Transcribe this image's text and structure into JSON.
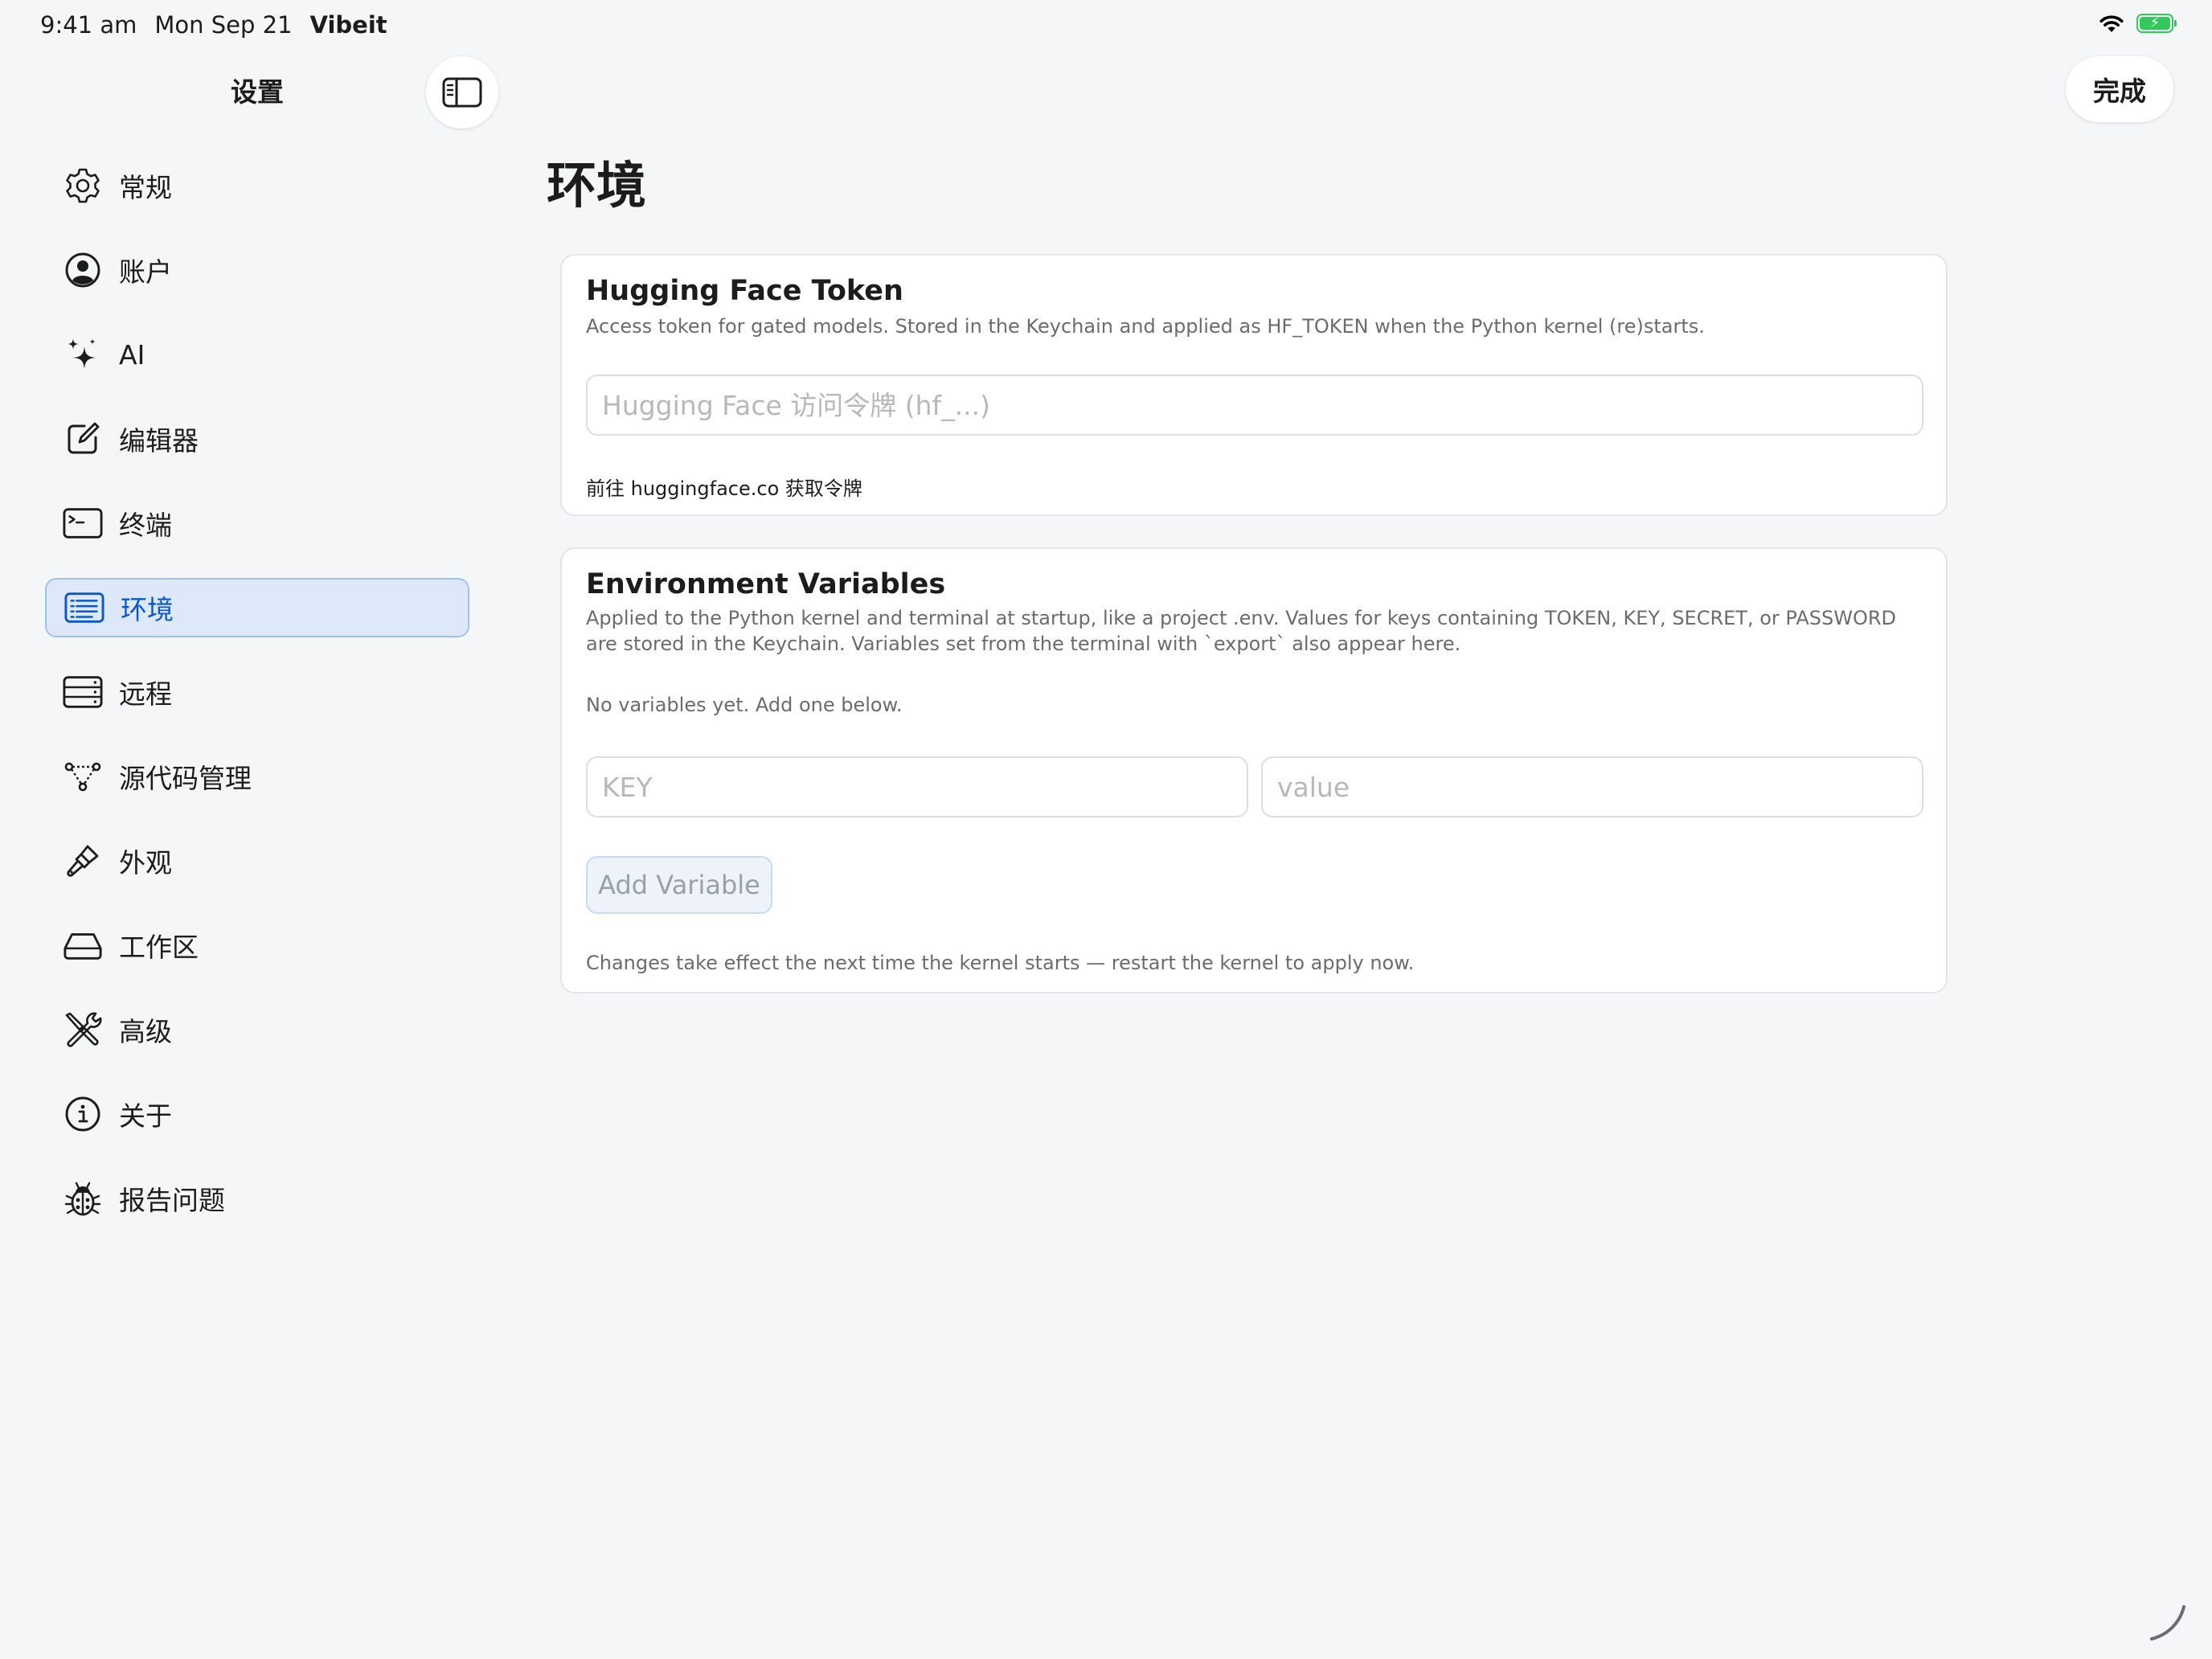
{
  "status_bar": {
    "time": "9:41 am",
    "date": "Mon Sep 21",
    "app": "Vibeit"
  },
  "sidebar": {
    "title": "设置",
    "items": [
      {
        "label": "常规",
        "icon": "gear-icon"
      },
      {
        "label": "账户",
        "icon": "account-icon"
      },
      {
        "label": "AI",
        "icon": "sparkles-icon"
      },
      {
        "label": "编辑器",
        "icon": "edit-icon"
      },
      {
        "label": "终端",
        "icon": "terminal-icon"
      },
      {
        "label": "环境",
        "icon": "list-icon",
        "selected": true
      },
      {
        "label": "远程",
        "icon": "server-icon"
      },
      {
        "label": "源代码管理",
        "icon": "branch-icon"
      },
      {
        "label": "外观",
        "icon": "paintbrush-icon"
      },
      {
        "label": "工作区",
        "icon": "drive-icon"
      },
      {
        "label": "高级",
        "icon": "tools-icon"
      },
      {
        "label": "关于",
        "icon": "info-icon"
      }
    ],
    "report": {
      "label": "报告问题",
      "icon": "ladybug-icon"
    }
  },
  "toolbar": {
    "done_label": "完成"
  },
  "main": {
    "title": "环境",
    "hf_card": {
      "title": "Hugging Face Token",
      "description": "Access token for gated models. Stored in the Keychain and applied as HF_TOKEN when the Python kernel (re)starts.",
      "token_placeholder": "Hugging Face 访问令牌 (hf_...)",
      "token_value": "",
      "link_label": "前往 huggingface.co 获取令牌"
    },
    "env_card": {
      "title": "Environment Variables",
      "description": "Applied to the Python kernel and terminal at startup, like a project .env. Values for keys containing TOKEN, KEY, SECRET, or PASSWORD are stored in the Keychain. Variables set from the terminal with `export` also appear here.",
      "empty_message": "No variables yet. Add one below.",
      "key_placeholder": "KEY",
      "value_placeholder": "value",
      "add_button_label": "Add Variable",
      "footer_note": "Changes take effect the next time the kernel starts — restart the kernel to apply now."
    }
  },
  "colors": {
    "accent": "#0a58c7",
    "selected_bg": "#dde9fb",
    "battery": "#34c759",
    "background": "#f5f6f8"
  }
}
